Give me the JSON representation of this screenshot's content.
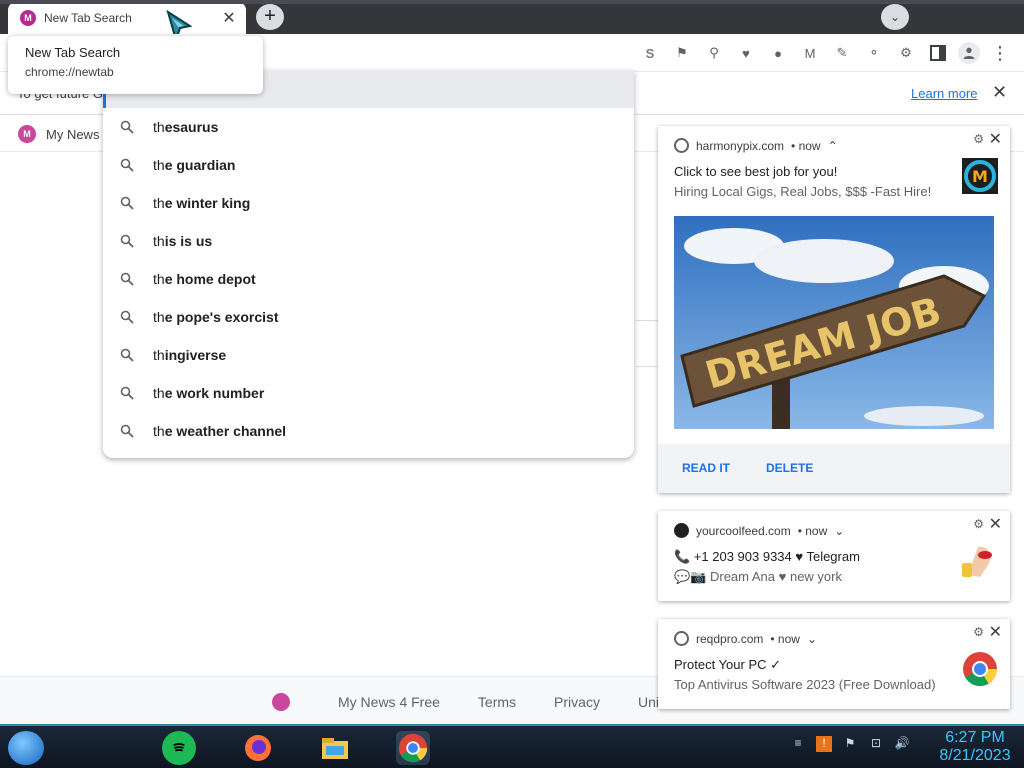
{
  "tab": {
    "title": "New Tab Search",
    "favicon_letter": "M",
    "close_glyph": "✕"
  },
  "tabstrip": {
    "new_tab_glyph": "+",
    "tab_search_glyph": "⌄"
  },
  "tooltip": {
    "title": "New Tab Search",
    "url": "chrome://newtab"
  },
  "infobar": {
    "text_prefix": "To get future G",
    "learn_more": "Learn more",
    "close_glyph": "✕"
  },
  "bookmarks": {
    "item_label": "My News"
  },
  "omnibox": {
    "suggestions": [
      {
        "typed": "th",
        "completion": "esaurus"
      },
      {
        "typed": "th",
        "completion": "e guardian"
      },
      {
        "typed": "th",
        "completion": "e winter king"
      },
      {
        "typed": "th",
        "completion": "is is us"
      },
      {
        "typed": "th",
        "completion": "e home depot"
      },
      {
        "typed": "th",
        "completion": "e pope's exorcist"
      },
      {
        "typed": "th",
        "completion": "ingiverse"
      },
      {
        "typed": "th",
        "completion": "e work number"
      },
      {
        "typed": "th",
        "completion": "e weather channel"
      }
    ]
  },
  "toolbar": {
    "extensions": [
      "S",
      "⚑",
      "⚲",
      "♥",
      "●",
      "M",
      "✎",
      "⚬",
      "⚙"
    ],
    "menu_glyph": "⋮"
  },
  "notifications": [
    {
      "origin": "harmonypix.com",
      "time": "• now",
      "expand_glyph": "⌃",
      "title": "Click to see best job for you!",
      "body": "Hiring Local Gigs, Real Jobs, $$$ -Fast Hire!",
      "image_text": "DREAM JOB",
      "actions": [
        "READ IT",
        "DELETE"
      ]
    },
    {
      "origin": "yourcoolfeed.com",
      "time": "• now",
      "expand_glyph": "⌄",
      "title": "📞 +1 203 903 9334 ♥ Telegram",
      "body": "💬📷 Dream Ana ♥ new york"
    },
    {
      "origin": "reqdpro.com",
      "time": "• now",
      "expand_glyph": "⌄",
      "title": "Protect Your PC ✓",
      "body": "Top Antivirus Software 2023 (Free Download)"
    }
  ],
  "footer": {
    "brand": "My News 4 Free",
    "links": [
      "Terms",
      "Privacy",
      "Uninstall"
    ]
  },
  "taskbar": {
    "time": "6:27 PM",
    "date": "8/21/2023"
  },
  "colors": {
    "accent": "#1a73e8",
    "tabstrip": "#35363a",
    "clock": "#39c6ff"
  }
}
